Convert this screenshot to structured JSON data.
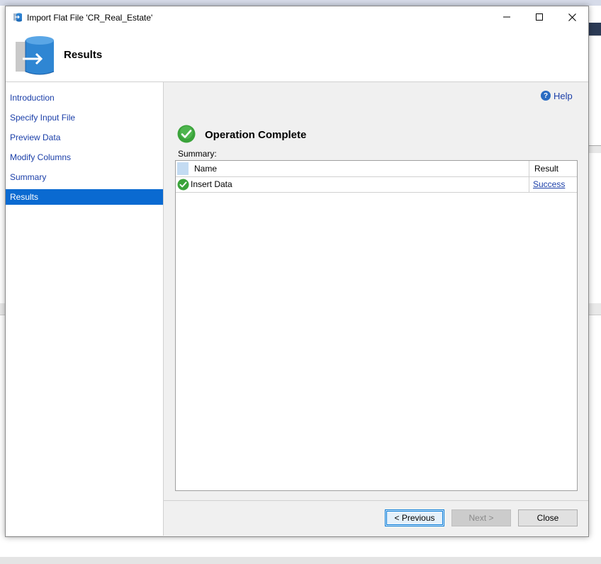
{
  "window": {
    "title": "Import Flat File 'CR_Real_Estate'",
    "minimize_glyph": "—",
    "maximize_glyph": "☐",
    "close_glyph": "✕"
  },
  "header": {
    "title": "Results",
    "icon": "database-import-icon"
  },
  "nav": {
    "items": [
      {
        "label": "Introduction",
        "active": false
      },
      {
        "label": "Specify Input File",
        "active": false
      },
      {
        "label": "Preview Data",
        "active": false
      },
      {
        "label": "Modify Columns",
        "active": false
      },
      {
        "label": "Summary",
        "active": false
      },
      {
        "label": "Results",
        "active": true
      }
    ]
  },
  "content": {
    "help_label": "Help",
    "status_title": "Operation Complete",
    "summary_label": "Summary:",
    "grid": {
      "columns": [
        "Name",
        "Result"
      ],
      "rows": [
        {
          "name": "Insert Data",
          "result": "Success"
        }
      ]
    }
  },
  "footer": {
    "previous_label": "< Previous",
    "next_label": "Next >",
    "close_label": "Close"
  },
  "colors": {
    "accent": "#0a6ad1",
    "link": "#1a3ea8",
    "success": "#3aa33a"
  }
}
